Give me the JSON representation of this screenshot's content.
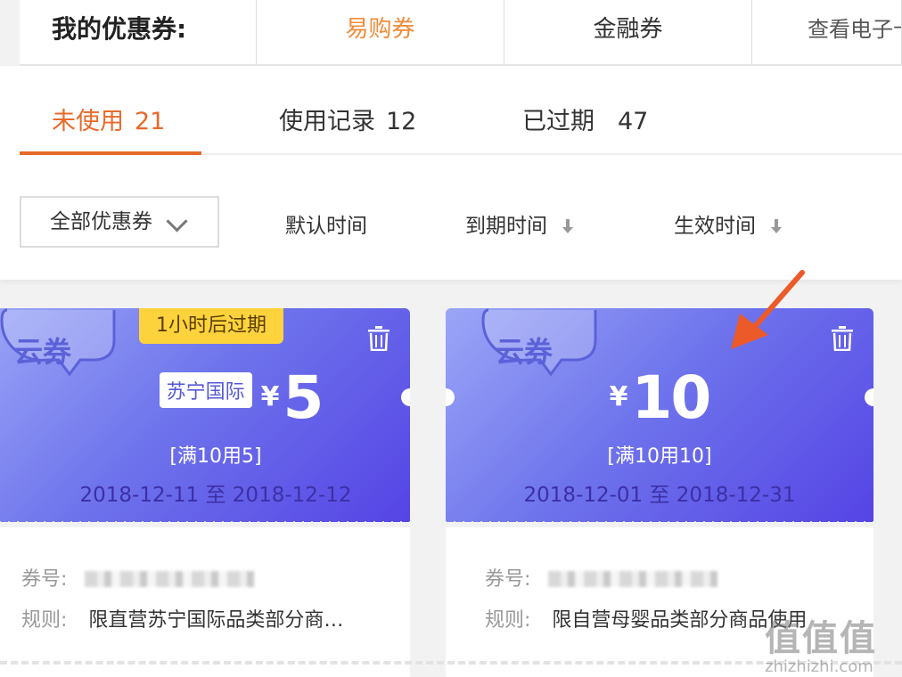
{
  "top_tabs": {
    "title": "我的优惠券:",
    "tabs": [
      {
        "label": "易购券",
        "active": true
      },
      {
        "label": "金融券",
        "active": false
      },
      {
        "label": "查看电子卡",
        "active": false
      }
    ]
  },
  "status_tabs": [
    {
      "label": "未使用",
      "count": "21",
      "active": true
    },
    {
      "label": "使用记录",
      "count": "12",
      "active": false
    },
    {
      "label": "已过期",
      "count": "47",
      "active": false
    }
  ],
  "filter": {
    "select_value": "全部优惠券",
    "sort_options": [
      "默认时间",
      "到期时间",
      "生效时间"
    ]
  },
  "coupons": [
    {
      "badge": "云券",
      "expire_tag": "1小时后过期",
      "brand": "苏宁国际",
      "currency": "¥",
      "amount": "5",
      "condition": "[满10用5]",
      "dates": "2018-12-11 至 2018-12-12",
      "code_label": "券号:",
      "rule_label": "规则:",
      "rule_text": "限直营苏宁国际品类部分商…"
    },
    {
      "badge": "云券",
      "currency": "¥",
      "amount": "10",
      "condition": "[满10用10]",
      "dates": "2018-12-01 至 2018-12-31",
      "code_label": "券号:",
      "rule_label": "规则:",
      "rule_text": "限自营母婴品类部分商品使用"
    }
  ],
  "watermark": {
    "logo": "值值值",
    "url": "zhizhizhi.com"
  },
  "colors": {
    "accent_orange": "#e86a2a",
    "coupon_gradient_start": "#9ba6f7",
    "coupon_gradient_end": "#5544e5",
    "expire_tag": "#fcd33c",
    "pointer_arrow": "#ec5a2a"
  }
}
